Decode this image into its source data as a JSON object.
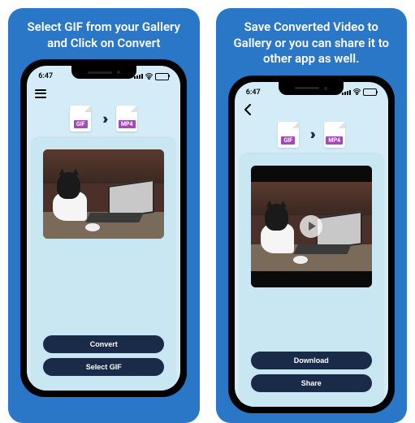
{
  "panels": [
    {
      "caption": "Select GIF from your Gallery and Click on Convert",
      "status_time": "6:47",
      "nav_icon": "hamburger",
      "from_format": "GIF",
      "to_format": "MP4",
      "preview_type": "gif",
      "buttons": [
        {
          "name": "convert-button",
          "label": "Convert"
        },
        {
          "name": "select-gif-button",
          "label": "Select GIF"
        }
      ]
    },
    {
      "caption": "Save Converted Video to Gallery or you can share it to other app as well.",
      "status_time": "6:47",
      "nav_icon": "back",
      "from_format": "GIF",
      "to_format": "MP4",
      "preview_type": "video",
      "buttons": [
        {
          "name": "download-button",
          "label": "Download"
        },
        {
          "name": "share-button",
          "label": "Share"
        }
      ]
    }
  ]
}
